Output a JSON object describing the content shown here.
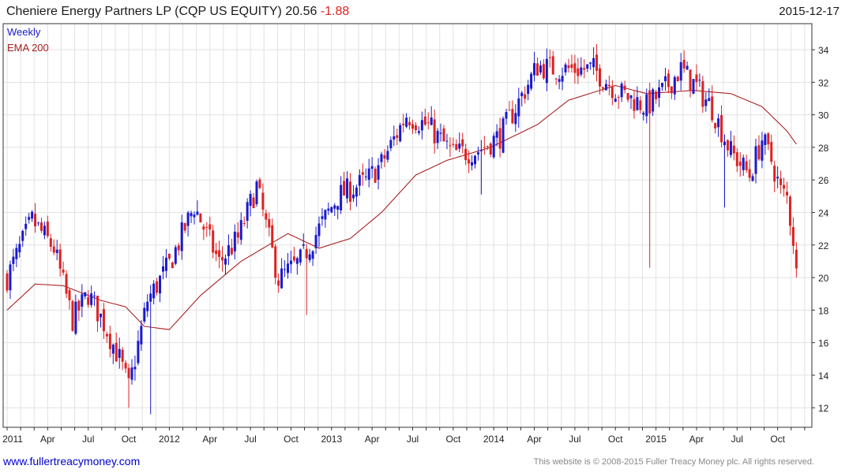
{
  "header": {
    "title": "Cheniere Energy Partners LP (CQP US EQUITY) 20.56",
    "change": "-1.88",
    "date": "2015-12-17"
  },
  "footer": {
    "website": "www.fullertreacymoney.com",
    "copyright": "This website is © 2008-2015 Fuller Treacy Money plc. All rights reserved."
  },
  "colors": {
    "up": "#1a1acc",
    "down": "#dd2222",
    "ema": "#aa2222",
    "grid": "#e2e2e2",
    "weekly_label": "#1a1acc",
    "ema_label": "#aa2222"
  },
  "chart_data": {
    "type": "candlestick",
    "interval_label": "Weekly",
    "indicator_label": "EMA 200",
    "x_tick_labels": [
      "2011",
      "Apr",
      "Jul",
      "Oct",
      "2012",
      "Apr",
      "Jul",
      "Oct",
      "2013",
      "Apr",
      "Jul",
      "Oct",
      "2014",
      "Apr",
      "Jul",
      "Oct",
      "2015",
      "Apr",
      "Jul",
      "Oct"
    ],
    "y_ticks": [
      12,
      14,
      16,
      18,
      20,
      22,
      24,
      26,
      28,
      30,
      32,
      34
    ],
    "ylim": [
      10.8,
      35.6
    ],
    "grid": true,
    "y_axis_side": "right",
    "close_path": [
      [
        0,
        20.0
      ],
      [
        8,
        23.5
      ],
      [
        15,
        21.8
      ],
      [
        21,
        17.4
      ],
      [
        26,
        19.0
      ],
      [
        31,
        17.2
      ],
      [
        36,
        15.0
      ],
      [
        39,
        13.2
      ],
      [
        45,
        18.6
      ],
      [
        52,
        20.8
      ],
      [
        60,
        24.4
      ],
      [
        68,
        20.9
      ],
      [
        74,
        22.4
      ],
      [
        80,
        25.6
      ],
      [
        87,
        19.9
      ],
      [
        94,
        21.0
      ],
      [
        100,
        23.0
      ],
      [
        106,
        25.0
      ],
      [
        115,
        25.9
      ],
      [
        120,
        27.0
      ],
      [
        128,
        30.0
      ],
      [
        135,
        29.3
      ],
      [
        143,
        27.6
      ],
      [
        151,
        27.8
      ],
      [
        158,
        28.7
      ],
      [
        164,
        30.8
      ],
      [
        170,
        33.0
      ],
      [
        176,
        32.8
      ],
      [
        188,
        32.8
      ],
      [
        196,
        31.4
      ],
      [
        205,
        30.5
      ],
      [
        210,
        31.4
      ],
      [
        216,
        32.8
      ],
      [
        221,
        31.7
      ],
      [
        226,
        30.4
      ],
      [
        232,
        27.7
      ],
      [
        238,
        26.3
      ],
      [
        242,
        28.5
      ],
      [
        245,
        27.2
      ],
      [
        248,
        25.3
      ],
      [
        250,
        24.9
      ],
      [
        252,
        22.4
      ],
      [
        253,
        20.56
      ]
    ],
    "spikes": [
      {
        "week": 152,
        "low": 25.1
      },
      {
        "week": 206,
        "low": 20.6
      },
      {
        "week": 230,
        "low": 24.3
      },
      {
        "week": 39,
        "low": 12.0
      },
      {
        "week": 46,
        "low": 11.6
      },
      {
        "week": 96,
        "low": 17.7
      }
    ],
    "ema_path": [
      [
        0,
        18.0
      ],
      [
        9,
        19.6
      ],
      [
        18,
        19.5
      ],
      [
        30,
        18.6
      ],
      [
        38,
        18.2
      ],
      [
        44,
        17.0
      ],
      [
        52,
        16.8
      ],
      [
        62,
        18.9
      ],
      [
        75,
        21.0
      ],
      [
        90,
        22.7
      ],
      [
        100,
        21.8
      ],
      [
        110,
        22.4
      ],
      [
        120,
        24.0
      ],
      [
        131,
        26.3
      ],
      [
        141,
        27.2
      ],
      [
        155,
        28.0
      ],
      [
        170,
        29.4
      ],
      [
        180,
        30.9
      ],
      [
        195,
        31.8
      ],
      [
        205,
        31.3
      ],
      [
        220,
        31.5
      ],
      [
        232,
        31.3
      ],
      [
        242,
        30.5
      ],
      [
        250,
        29.0
      ],
      [
        253,
        28.2
      ]
    ]
  }
}
